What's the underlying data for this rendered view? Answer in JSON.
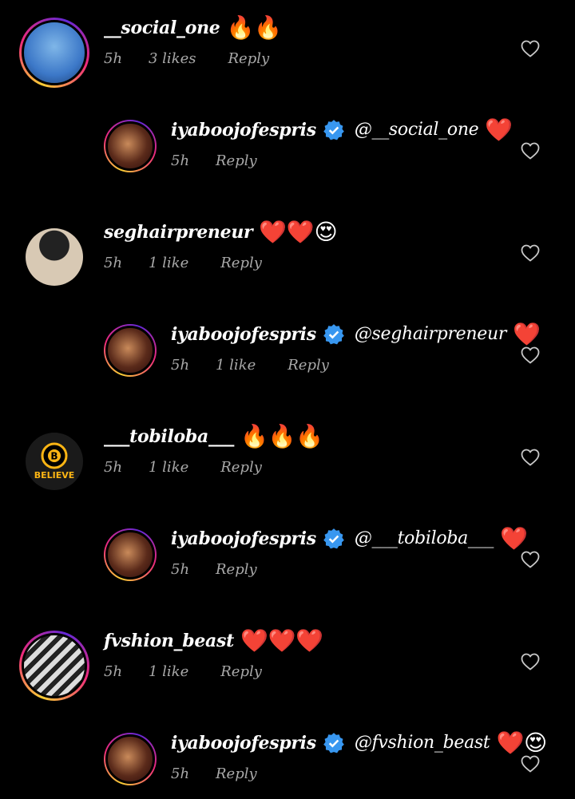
{
  "comments": [
    {
      "username": "__social_one",
      "text": "",
      "emoji": "🔥🔥",
      "time": "5h",
      "likes": "3 likes",
      "reply": "Reply"
    },
    {
      "username": "iyaboojofespris",
      "text": "@__social_one",
      "emoji": "❤️",
      "time": "5h",
      "likes": "",
      "reply": "Reply"
    },
    {
      "username": "seghairpreneur",
      "text": "",
      "emoji": "❤️❤️😍",
      "time": "5h",
      "likes": "1 like",
      "reply": "Reply"
    },
    {
      "username": "iyaboojofespris",
      "text": "@seghairpreneur",
      "emoji": "❤️",
      "time": "5h",
      "likes": "1 like",
      "reply": "Reply"
    },
    {
      "username": "___tobiloba___",
      "text": "",
      "emoji": "🔥🔥🔥",
      "time": "5h",
      "likes": "1 like",
      "reply": "Reply"
    },
    {
      "username": "iyaboojofespris",
      "text": "@___tobiloba___",
      "emoji": "❤️",
      "time": "5h",
      "likes": "",
      "reply": "Reply"
    },
    {
      "username": "fvshion_beast",
      "text": "",
      "emoji": "❤️❤️❤️",
      "time": "5h",
      "likes": "1 like",
      "reply": "Reply"
    },
    {
      "username": "iyaboojofespris",
      "text": "@fvshion_beast",
      "emoji": "❤️😍",
      "time": "5h",
      "likes": "",
      "reply": "Reply"
    }
  ],
  "avatar_badge_text": "BELIEVE",
  "colors": {
    "background": "#000000",
    "meta": "#a8a8a8",
    "verified": "#3897f0"
  },
  "icons": {
    "like": "heart-outline-icon",
    "verified": "verified-badge-icon"
  }
}
